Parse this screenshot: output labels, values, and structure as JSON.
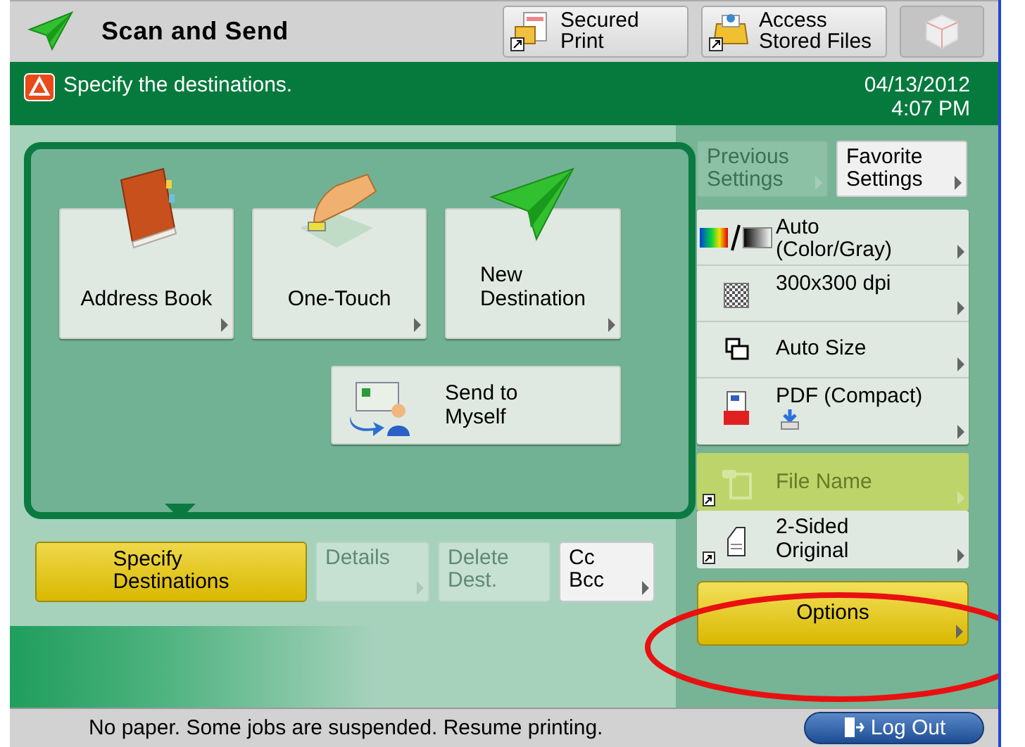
{
  "header": {
    "title": "Scan and Send",
    "buttons": [
      {
        "label": "Secured\nPrint",
        "disabled": false
      },
      {
        "label": "Access\nStored Files",
        "disabled": false
      },
      {
        "disabled": true
      }
    ]
  },
  "message_bar": {
    "text": "Specify the destinations.",
    "date": "04/13/2012",
    "time": "4:07 PM"
  },
  "destination_buttons": [
    {
      "label": "Address Book",
      "arrow": true
    },
    {
      "label": "One-Touch",
      "arrow": true
    },
    {
      "label": "New\nDestination",
      "arrow": true
    },
    {
      "label": "Send to\nMyself",
      "arrow": false
    }
  ],
  "tabs": [
    {
      "label": "Specify\nDestinations",
      "selected": true,
      "disabled": false,
      "arrow": false
    },
    {
      "label": "Details",
      "selected": false,
      "disabled": true,
      "arrow": true
    },
    {
      "label": "Delete\nDest.",
      "selected": false,
      "disabled": true,
      "arrow": false
    },
    {
      "label": "Cc\nBcc",
      "selected": false,
      "disabled": false,
      "arrow": true
    }
  ],
  "quick_buttons": [
    {
      "label": "Previous\nSettings",
      "disabled": true
    },
    {
      "label": "Favorite\nSettings",
      "disabled": false
    }
  ],
  "settings": [
    {
      "label": "Auto\n(Color/Gray)"
    },
    {
      "label": "300x300 dpi"
    },
    {
      "label": "Auto Size"
    },
    {
      "label": "PDF (Compact)"
    }
  ],
  "more_settings": [
    {
      "label": "File Name",
      "disabled": true
    },
    {
      "label": "2-Sided\nOriginal",
      "disabled": false
    }
  ],
  "options_button": {
    "label": "Options",
    "arrow": true
  },
  "footer": {
    "message": "No paper. Some jobs are suspended. Resume printing.",
    "logout": "Log Out"
  }
}
